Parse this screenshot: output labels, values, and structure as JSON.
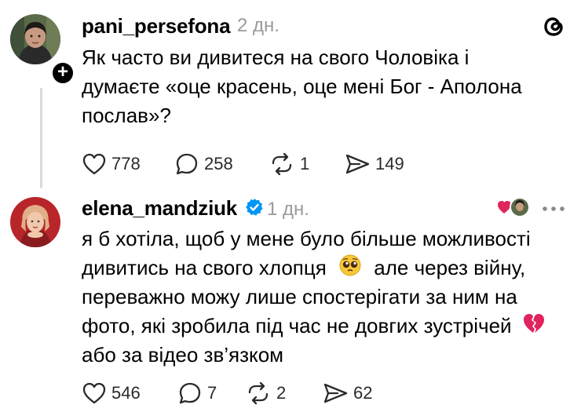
{
  "colors": {
    "text": "#000000",
    "muted": "#9a9a9a",
    "verified": "#0095f6",
    "heart_red": "#e0245e"
  },
  "post": {
    "username": "pani_persefona",
    "time": "2 дн.",
    "text_lines": [
      "Як часто ви дивитеся на свого Чоловіка і",
      "думаєте «оце красень, оце мені Бог - Аполона",
      "послав»?"
    ],
    "likes": "778",
    "comments": "258",
    "reposts": "1",
    "shares": "149"
  },
  "reply": {
    "username": "elena_mandziuk",
    "time": "1 дн.",
    "line1": "я б хотіла, щоб у мене було більше можливості",
    "line2a": "дивитись на свого хлопця",
    "line2b": "але через війну,",
    "line3": "переважно можу лише спостерігати за ним на",
    "line4": "фото, які зробила під час не довгих зустрічей",
    "line5": "або за відео зв’язком",
    "likes": "546",
    "comments": "7",
    "reposts": "2",
    "shares": "62"
  },
  "icons": {
    "app_logo": "threads-logo-icon",
    "more": "more-options-icon",
    "liked_by_author": "heart-avatar-icon"
  }
}
